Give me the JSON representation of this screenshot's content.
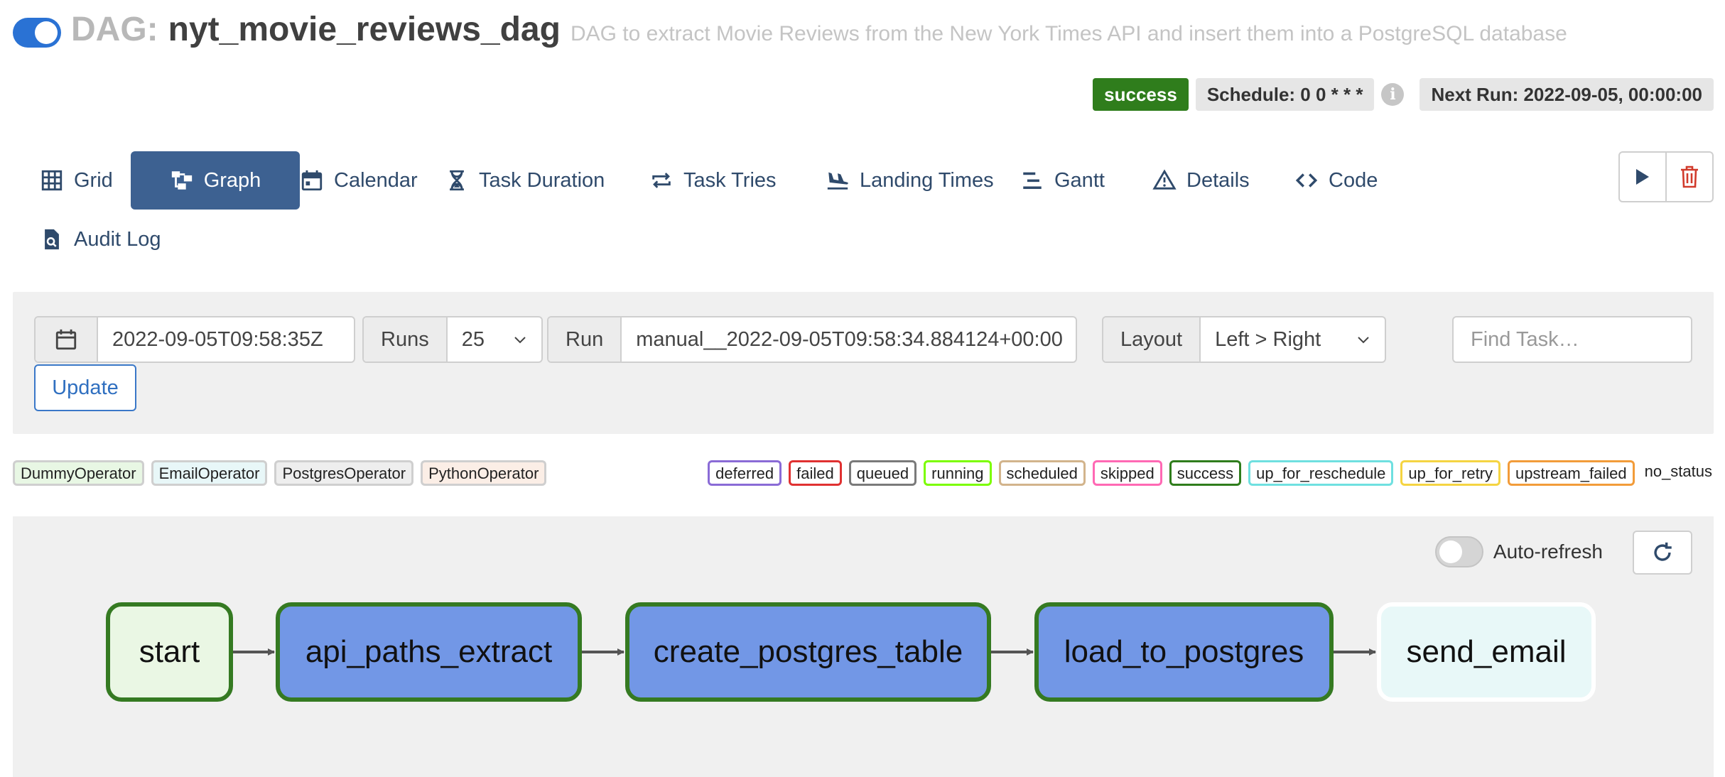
{
  "header": {
    "dag_prefix": "DAG:",
    "dag_name": "nyt_movie_reviews_dag",
    "description": "DAG to extract Movie Reviews from the New York Times API and insert them into a PostgreSQL database",
    "status": "success",
    "schedule": "Schedule: 0 0 * * *",
    "next_run": "Next Run: 2022-09-05, 00:00:00",
    "paused": false
  },
  "tabs": [
    {
      "label": "Grid",
      "icon": "grid-icon"
    },
    {
      "label": "Graph",
      "icon": "graph-icon",
      "active": true
    },
    {
      "label": "Calendar",
      "icon": "calendar-icon"
    },
    {
      "label": "Task Duration",
      "icon": "hourglass-icon"
    },
    {
      "label": "Task Tries",
      "icon": "repeat-icon"
    },
    {
      "label": "Landing Times",
      "icon": "plane-landing-icon"
    },
    {
      "label": "Gantt",
      "icon": "gantt-icon"
    },
    {
      "label": "Details",
      "icon": "warning-triangle-icon"
    },
    {
      "label": "Code",
      "icon": "code-icon"
    },
    {
      "label": "Audit Log",
      "icon": "file-search-icon"
    }
  ],
  "controls": {
    "base_date": "2022-09-05T09:58:35Z",
    "runs_label": "Runs",
    "runs_value": "25",
    "run_label": "Run",
    "run_value": "manual__2022-09-05T09:58:34.884124+00:00",
    "layout_label": "Layout",
    "layout_value": "Left > Right",
    "find_placeholder": "Find Task…",
    "update_label": "Update"
  },
  "operator_legend": [
    {
      "label": "DummyOperator",
      "color": "#e8f7e4"
    },
    {
      "label": "EmailOperator",
      "color": "#e8f7f8"
    },
    {
      "label": "PostgresOperator",
      "color": "#eeeeee"
    },
    {
      "label": "PythonOperator",
      "color": "#fbeee6"
    }
  ],
  "state_legend": [
    {
      "label": "deferred",
      "color": "#8a6bd6"
    },
    {
      "label": "failed",
      "color": "#e03131"
    },
    {
      "label": "queued",
      "color": "#7a7a7a"
    },
    {
      "label": "running",
      "color": "#7cfc00"
    },
    {
      "label": "scheduled",
      "color": "#d2b48c"
    },
    {
      "label": "skipped",
      "color": "#ff69b4"
    },
    {
      "label": "success",
      "color": "#2f7d1c"
    },
    {
      "label": "up_for_reschedule",
      "color": "#6fe0e0"
    },
    {
      "label": "up_for_retry",
      "color": "#f5d442"
    },
    {
      "label": "upstream_failed",
      "color": "#f29c3a"
    },
    {
      "label": "no_status",
      "color": ""
    }
  ],
  "graph": {
    "auto_refresh_label": "Auto-refresh",
    "auto_refresh_on": false,
    "nodes": [
      {
        "label": "start",
        "operator": "DummyOperator",
        "state": "success"
      },
      {
        "label": "api_paths_extract",
        "operator": "PythonOperator",
        "state": "success"
      },
      {
        "label": "create_postgres_table",
        "operator": "PostgresOperator",
        "state": "success"
      },
      {
        "label": "load_to_postgres",
        "operator": "PythonOperator",
        "state": "success"
      },
      {
        "label": "send_email",
        "operator": "EmailOperator",
        "state": "no_status"
      }
    ]
  }
}
